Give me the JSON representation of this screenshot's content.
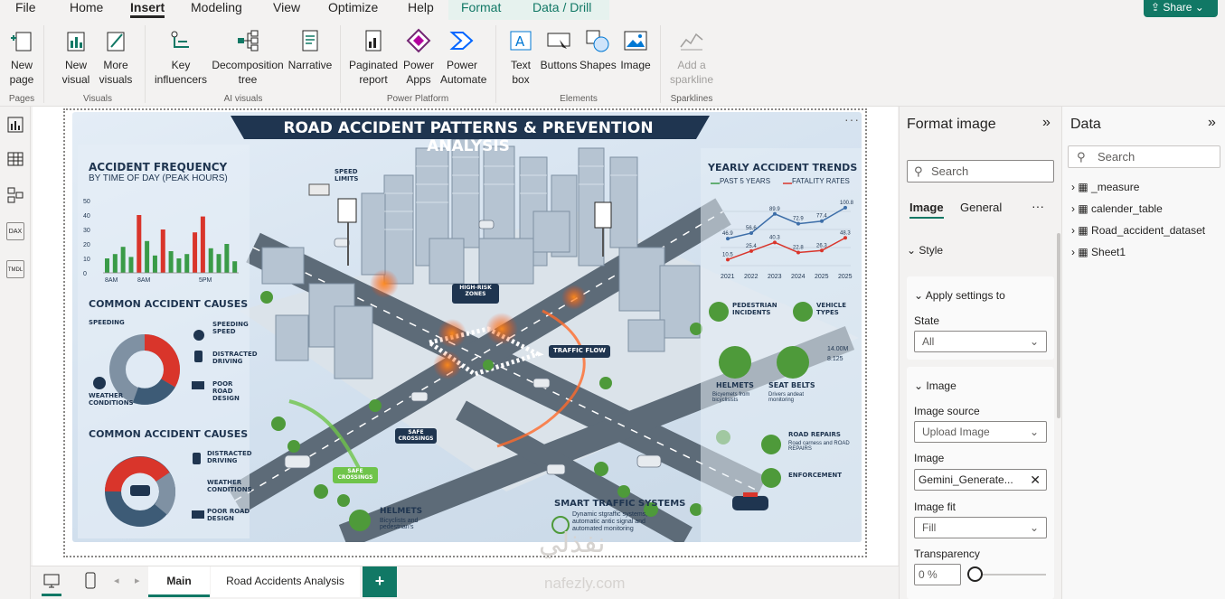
{
  "menu": {
    "tabs": [
      "File",
      "Home",
      "Insert",
      "Modeling",
      "View",
      "Optimize",
      "Help",
      "Format",
      "Data / Drill"
    ],
    "share": "Share"
  },
  "ribbon": {
    "new_page": "New page",
    "new_visual": "New visual",
    "more_visuals": "More visuals",
    "key_influencers": "Key influencers",
    "decomp": "Decomposition tree",
    "narrative": "Narrative",
    "paginated": "Paginated report",
    "power_apps": "Power Apps",
    "power_automate": "Power Automate",
    "text_box": "Text box",
    "buttons": "Buttons",
    "shapes": "Shapes",
    "image": "Image",
    "sparkline": "Add a sparkline",
    "groups": {
      "pages": "Pages",
      "visuals": "Visuals",
      "ai": "AI visuals",
      "platform": "Power Platform",
      "elements": "Elements",
      "sparklines": "Sparklines"
    }
  },
  "leftrail": {
    "dax": "DAX",
    "tmdl": "TMDL"
  },
  "infographic": {
    "title": "ROAD ACCIDENT PATTERNS & PREVENTION ANALYSIS",
    "freq_title": "ACCIDENT FREQUENCY",
    "freq_sub": "BY TIME OF DAY (PEAK HOURS)",
    "freq_ticks": [
      "50",
      "40",
      "30",
      "20",
      "10",
      "0"
    ],
    "freq_x": [
      "8AM",
      "8AM",
      "5PM"
    ],
    "yearly_title": "YEARLY ACCIDENT TRENDS",
    "yearly_l1": "PAST 5 YEARS",
    "yearly_l2": "FATALITY RATES",
    "yearly_x": [
      "2021",
      "2022",
      "2023",
      "2024",
      "2025",
      "2025"
    ],
    "yearly_labels": [
      "46.9",
      "56.6",
      "89.9",
      "72.9",
      "77.4",
      "100.8",
      "10.5",
      "25.4",
      "40.3",
      "22.8",
      "26.3",
      "48.3"
    ],
    "causes1_title": "COMMON ACCIDENT CAUSES",
    "causes1": [
      "SPEEDING",
      "SPEEDING SPEED",
      "DISTRACTED DRIVING",
      "WEATHER CONDITIONS",
      "POOR ROAD DESIGN"
    ],
    "causes2_title": "COMMON ACCIDENT CAUSES",
    "causes2": [
      "DISTRACTED DRIVING",
      "WEATHER CONDITIONS",
      "POOR ROAD DESIGN"
    ],
    "speed_limits": "SPEED LIMITS",
    "high_risk": "HIGH-RISK ZONES",
    "traffic_flow": "TRAFFIC FLOW",
    "safe_crossings": "SAFE CROSSINGS",
    "safe_crossings2": "SAFE CROSSINGS",
    "helmets_b_title": "HELMETS",
    "helmets_b_sub": "Bicyclists and pedestrian's",
    "smart_title": "SMART TRAFFIC SYSTEMS",
    "smart_sub": "Dynamic stgraffic systems, automatic antic signal and automated monitoring",
    "ped": "PEDESTRIAN INCIDENTS",
    "vehicle": "VEHICLE TYPES",
    "helmets_title": "HELMETS",
    "helmets_sub": "Bicyemets from bicyclisists",
    "belts_title": "SEAT BELTS",
    "belts_sub": "Drivers andeat monitoring",
    "belts_v1": "14.00M",
    "belts_v2": "8.125",
    "repairs_title": "ROAD REPAIRS",
    "repairs_sub": "Road carness and ROAD REPAIRS",
    "enforcement": "ENFORCEMENT"
  },
  "chart_data": [
    {
      "type": "bar",
      "title": "ACCIDENT FREQUENCY",
      "subtitle": "BY TIME OF DAY (PEAK HOURS)",
      "ylim": [
        0,
        50
      ],
      "categories": [
        "",
        "",
        "",
        "",
        "",
        "",
        "",
        "",
        "",
        "",
        "",
        "",
        "",
        "",
        "",
        "",
        ""
      ],
      "values": [
        10,
        13,
        18,
        11,
        40,
        22,
        12,
        30,
        15,
        10,
        13,
        28,
        39,
        17,
        13,
        20,
        8
      ]
    },
    {
      "type": "line",
      "title": "YEARLY ACCIDENT TRENDS",
      "categories": [
        "2021",
        "2022",
        "2023",
        "2024",
        "2025",
        "2025"
      ],
      "series": [
        {
          "name": "PAST 5 YEARS",
          "values": [
            46.9,
            56.6,
            89.9,
            72.9,
            77.4,
            100.8
          ]
        },
        {
          "name": "FATALITY RATES",
          "values": [
            10.5,
            25.4,
            40.3,
            22.8,
            26.3,
            48.3
          ]
        }
      ]
    }
  ],
  "pages": {
    "main": "Main",
    "second": "Road Accidents Analysis",
    "add": "+"
  },
  "format": {
    "title": "Format image",
    "search": "Search",
    "tab_image": "Image",
    "tab_general": "General",
    "more": "···",
    "style": "Style",
    "apply": "Apply settings to",
    "state": "State",
    "state_val": "All",
    "image_section": "Image",
    "image_source": "Image source",
    "image_source_val": "Upload Image",
    "image_label": "Image",
    "image_val": "Gemini_Generate...",
    "fit": "Image fit",
    "fit_val": "Fill",
    "transparency": "Transparency",
    "transparency_val": "0 %"
  },
  "data": {
    "title": "Data",
    "search": "Search",
    "items": [
      "_measure",
      "calender_table",
      "Road_accident_dataset",
      "Sheet1"
    ]
  },
  "watermark": {
    "line1": "نفذلي",
    "line2": "nafezly.com"
  },
  "colors": {
    "accent": "#117865",
    "red": "#d9352b",
    "green": "#3a9b48",
    "navy": "#1f3550"
  }
}
